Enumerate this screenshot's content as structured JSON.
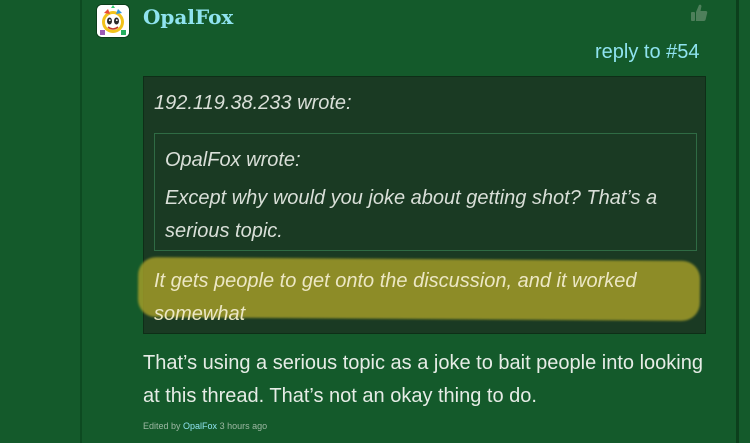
{
  "post": {
    "username": "OpalFox",
    "reply_to": "reply to #54",
    "quote": {
      "author_line": "192.119.38.233 wrote:",
      "inner": {
        "author_line": "OpalFox wrote:",
        "text": "Except why would you joke about getting shot? That’s a serious topic."
      },
      "text": "It gets people to get onto the discussion, and it worked somewhat"
    },
    "body": "That’s using a serious topic as a joke to bait people into looking at this thread. That’s not an okay thing to do.",
    "edited": {
      "prefix": "Edited by",
      "user": "OpalFox",
      "time": "3 hours ago"
    }
  },
  "icons": {
    "like": "thumbs-up-icon",
    "avatar": "cartoon-avatar"
  },
  "colors": {
    "background": "#145a2b",
    "link": "#8fe3ef",
    "quote_background": "#1a3a23",
    "highlight": "#a79f29"
  }
}
